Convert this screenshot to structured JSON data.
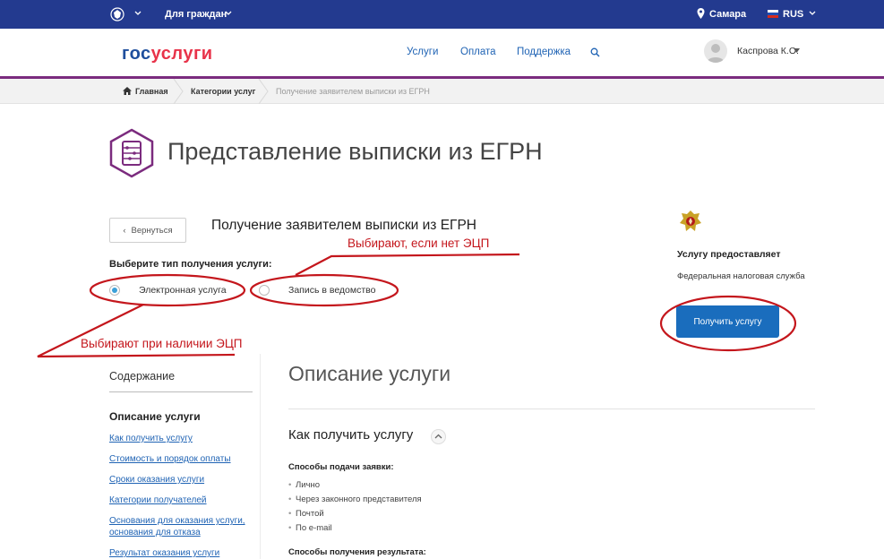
{
  "topbar": {
    "for_citizens": "Для граждан",
    "city": "Самара",
    "lang": "RUS",
    "flag_colors": [
      "#ffffff",
      "#1f4fb5",
      "#d52b1e"
    ]
  },
  "header": {
    "logo_part1": "гос",
    "logo_part2": "услуги",
    "nav": [
      "Услуги",
      "Оплата",
      "Поддержка"
    ],
    "user_name": "Каспрова К.О."
  },
  "breadcrumbs": [
    "Главная",
    "Категории услуг",
    "Получение заявителем выписки из ЕГРН"
  ],
  "page": {
    "title": "Представление выписки из ЕГРН",
    "back_label": "Вернуться",
    "subtitle": "Получение заявителем выписки из ЕГРН",
    "choose_label": "Выберите тип получения услуги:",
    "options": [
      "Электронная услуга",
      "Запись в ведомство"
    ],
    "selected_option": "Электронная услуга"
  },
  "annotations": {
    "no_ecp": "Выбирают, если нет ЭЦП",
    "with_ecp": "Выбирают при наличии ЭЦП",
    "color": "#c4161c"
  },
  "provider": {
    "label": "Услугу предоставляет",
    "name": "Федеральная налоговая служба",
    "button": "Получить услугу"
  },
  "toc": {
    "title": "Содержание",
    "section": "Описание услуги",
    "links": [
      "Как получить услугу",
      "Стоимость и порядок оплаты",
      "Сроки оказания услуги",
      "Категории получателей",
      "Основания для оказания услуги, основания для отказа",
      "Результат оказания услуги"
    ]
  },
  "main": {
    "desc_title": "Описание услуги",
    "how_title": "Как получить услугу",
    "methods_label": "Способы подачи заявки:",
    "methods": [
      "Лично",
      "Через законного представителя",
      "Почтой",
      "По e-mail"
    ],
    "results_label": "Способы получения результата:"
  },
  "colors": {
    "topbar": "#233a8f",
    "accent_purple": "#7b2b7e",
    "link": "#1f63b4",
    "button": "#1a6dbd"
  }
}
